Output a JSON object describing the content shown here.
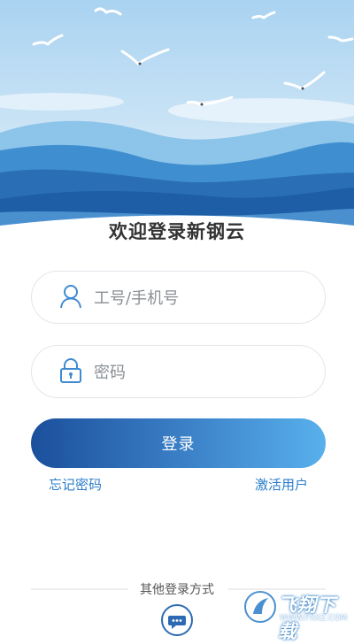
{
  "welcome_title": "欢迎登录新钢云",
  "fields": {
    "account_placeholder": "工号/手机号",
    "password_placeholder": "密码"
  },
  "login_label": "登录",
  "links": {
    "forgot_password": "忘记密码",
    "activate_user": "激活用户"
  },
  "other_login_label": "其他登录方式",
  "colors": {
    "accent": "#2a7ecb",
    "button_start": "#1b4f9c",
    "button_end": "#58b0ec",
    "sky": "#c9e3f4"
  },
  "icons": {
    "account": "user-icon",
    "password": "lock-icon",
    "other_login": "chat-icon"
  },
  "watermark": {
    "brand": "飞翔下载",
    "domain": "WWW.FXXZ.COM"
  }
}
